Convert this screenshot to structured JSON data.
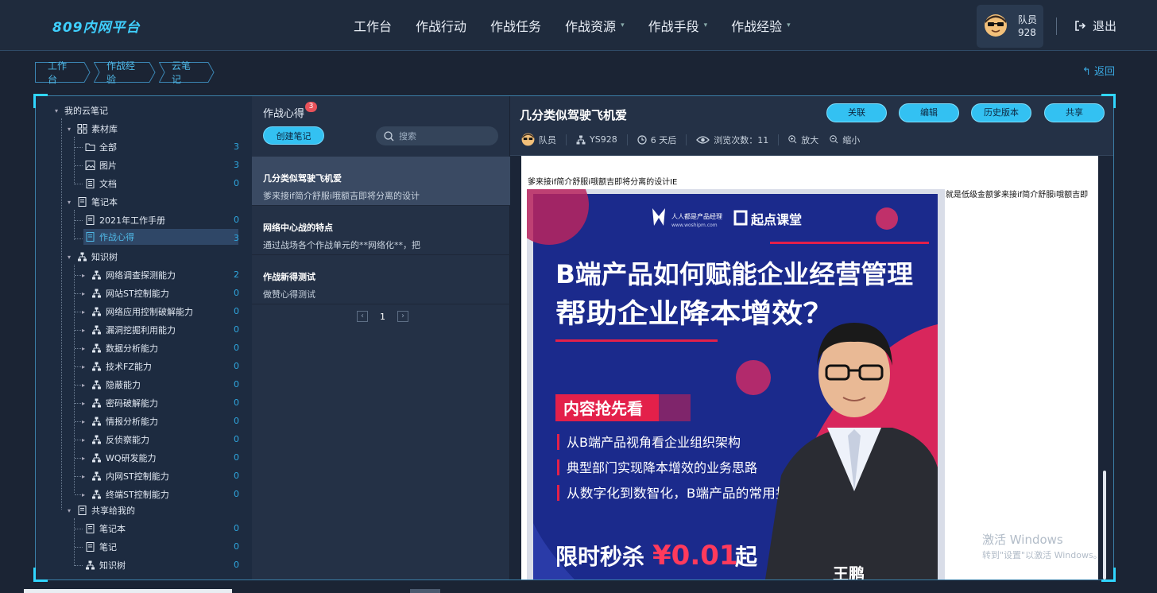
{
  "app": {
    "logo": "809内网平台"
  },
  "nav": [
    {
      "label": "工作台",
      "dropdown": false
    },
    {
      "label": "作战行动",
      "dropdown": false
    },
    {
      "label": "作战任务",
      "dropdown": false
    },
    {
      "label": "作战资源",
      "dropdown": true
    },
    {
      "label": "作战手段",
      "dropdown": true
    },
    {
      "label": "作战经验",
      "dropdown": true
    }
  ],
  "user": {
    "role": "队员",
    "id": "928",
    "logout": "退出"
  },
  "breadcrumb": [
    "工作台",
    "作战经验",
    "云笔记"
  ],
  "back_label": "返回",
  "tree": {
    "root": "我的云笔记",
    "material": {
      "label": "素材库",
      "items": [
        {
          "label": "全部",
          "count": "3"
        },
        {
          "label": "图片",
          "count": "3"
        },
        {
          "label": "文档",
          "count": "0"
        }
      ]
    },
    "notebook": {
      "label": "笔记本",
      "items": [
        {
          "label": "2021年工作手册",
          "count": "0"
        },
        {
          "label": "作战心得",
          "count": "3"
        }
      ]
    },
    "knowledge": {
      "label": "知识树",
      "items": [
        {
          "label": "网络调查探测能力",
          "count": "2"
        },
        {
          "label": "网站ST控制能力",
          "count": "0"
        },
        {
          "label": "网络应用控制破解能力",
          "count": "0"
        },
        {
          "label": "漏洞挖掘利用能力",
          "count": "0"
        },
        {
          "label": "数据分析能力",
          "count": "0"
        },
        {
          "label": "技术FZ能力",
          "count": "0"
        },
        {
          "label": "隐蔽能力",
          "count": "0"
        },
        {
          "label": "密码破解能力",
          "count": "0"
        },
        {
          "label": "情报分析能力",
          "count": "0"
        },
        {
          "label": "反侦察能力",
          "count": "0"
        },
        {
          "label": "WQ研发能力",
          "count": "0"
        },
        {
          "label": "内网ST控制能力",
          "count": "0"
        },
        {
          "label": "终端ST控制能力",
          "count": "0"
        }
      ]
    },
    "shared": {
      "label": "共享给我的",
      "items": [
        {
          "label": "笔记本",
          "count": "0"
        },
        {
          "label": "笔记",
          "count": "0"
        },
        {
          "label": "知识树",
          "count": "0"
        }
      ]
    }
  },
  "list": {
    "title": "作战心得",
    "badge": "3",
    "create_label": "创建笔记",
    "search_placeholder": "搜索",
    "notes": [
      {
        "title": "几分类似驾驶飞机爱",
        "summary": "爹来接if简介舒服i哦额吉即将分离的设计"
      },
      {
        "title": "网络中心战的特点",
        "summary": "通过战场各个作战单元的**网络化**，把"
      },
      {
        "title": "作战新得测试",
        "summary": "做赞心得测试"
      }
    ],
    "page": "1"
  },
  "detail": {
    "title": "几分类似驾驶飞机爱",
    "actions": [
      "关联",
      "编辑",
      "历史版本",
      "共享"
    ],
    "meta": {
      "author": "队员",
      "code": "YS928",
      "time": "6 天后",
      "views": "浏览次数：11",
      "zoom_in": "放大",
      "zoom_out": "缩小"
    },
    "line1": "爹来接if简介舒服i哦额吉即将分离的设计IE",
    "line2": "就是低级金额爹来接if简介舒服i哦额吉即",
    "poster": {
      "brand1": "人人都是产品经理",
      "brand1_url": "www.woshipm.com",
      "brand2": "起点课堂",
      "headline1": "B端产品如何赋能企业经营管理",
      "headline2": "帮助企业降本增效？",
      "section": "内容抢先看",
      "bullets": [
        "从B端产品视角看企业组织架构",
        "典型部门实现降本增效的业务思路",
        "从数字化到数智化，B端产品的常用技术手段"
      ],
      "promo_prefix": "限时秒杀",
      "promo_price": "¥0.01",
      "promo_suffix": "起",
      "name": "王鹏"
    }
  },
  "watermark": {
    "line1": "激活 Windows",
    "line2": "转到\"设置\"以激活 Windows。"
  },
  "colors": {
    "accent": "#33c1f2",
    "badge": "#e9525a",
    "poster_bg": "#1b2a8c",
    "poster_red": "#e3204a"
  }
}
